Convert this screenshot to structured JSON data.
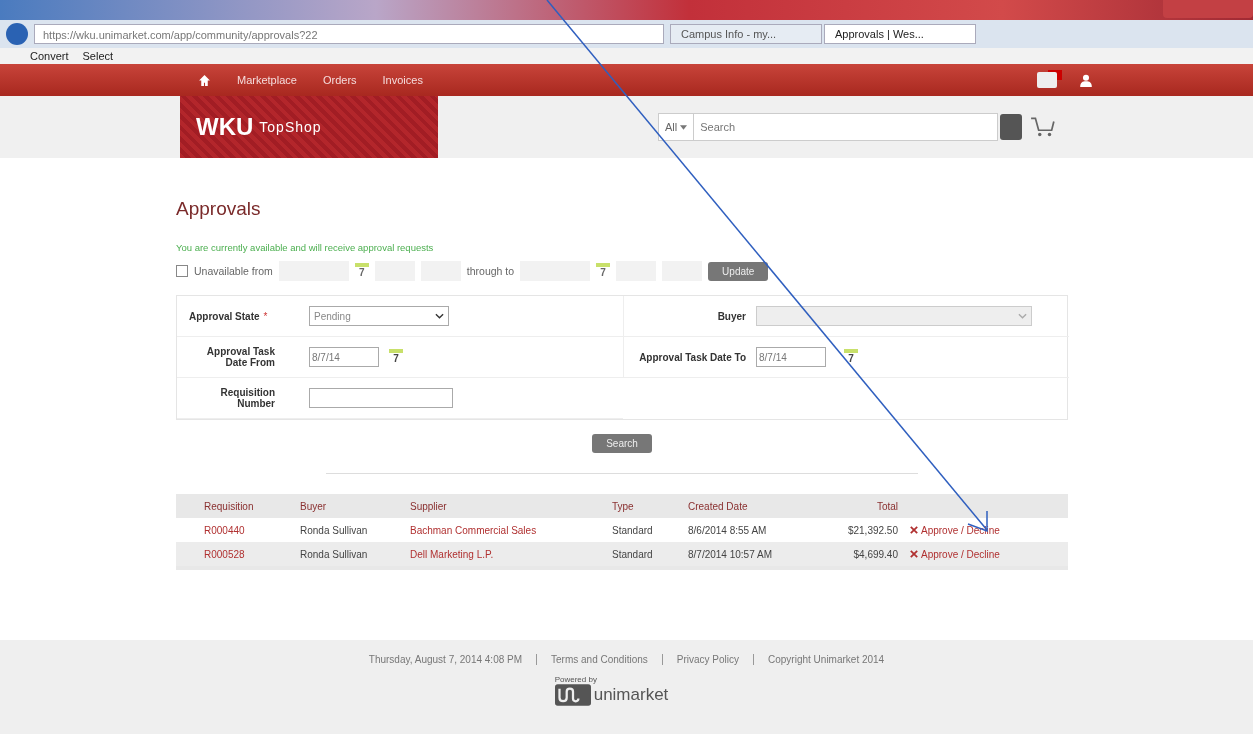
{
  "browser": {
    "url": "https://wku.unimarket.com/app/community/approvals?22",
    "tabs": [
      {
        "label": "Campus Info - my...",
        "selected": false
      },
      {
        "label": "Approvals | Wes...",
        "selected": true
      }
    ],
    "toolbar": [
      "Convert",
      "Select"
    ]
  },
  "nav": {
    "items": [
      "Marketplace",
      "Orders",
      "Invoices"
    ]
  },
  "header": {
    "logo_main": "WKU",
    "logo_sub": "TopShop",
    "search_scope": "All",
    "search_placeholder": "Search"
  },
  "page": {
    "title": "Approvals",
    "status_message": "You are currently available and will receive approval requests",
    "unavailable_label": "Unavailable from",
    "unavailable_checked": false,
    "from_calendar_day": "7",
    "through_label": "through to",
    "to_calendar_day": "7",
    "update_button": "Update"
  },
  "filters": [
    {
      "kind": "select",
      "label": "Approval State",
      "required_mark": "*",
      "value": "Pending",
      "disabled": false
    },
    {
      "kind": "select",
      "label": "Buyer",
      "disabled": true
    },
    {
      "kind": "date",
      "label": "Approval Task Date From",
      "value": "8/7/14",
      "calendar_day": "7",
      "disabled": false
    },
    {
      "kind": "date",
      "label": "Approval Task Date To",
      "value": "8/7/14",
      "calendar_day": "7",
      "disabled": false
    },
    {
      "kind": "text",
      "label": "Requisition Number",
      "disabled": false
    }
  ],
  "search_button": "Search",
  "table": {
    "columns": [
      "Requisition",
      "Buyer",
      "Supplier",
      "Type",
      "Created Date",
      "Total"
    ],
    "rows": [
      {
        "requisition": "R000440",
        "buyer": "Ronda Sullivan",
        "supplier": "Bachman Commercial Sales",
        "type": "Standard",
        "created": "8/6/2014 8:55 AM",
        "total": "$21,392.50",
        "action": "Approve / Decline"
      },
      {
        "requisition": "R000528",
        "buyer": "Ronda Sullivan",
        "supplier": "Dell Marketing L.P.",
        "type": "Standard",
        "created": "8/7/2014 10:57 AM",
        "total": "$4,699.40",
        "action": "Approve / Decline"
      }
    ]
  },
  "footer": {
    "items": [
      "Thursday, August 7, 2014 4:08 PM",
      "Terms and Conditions",
      "Privacy Policy",
      "Copyright Unimarket 2014"
    ],
    "powered_by": "Powered by",
    "brand": "unimarket"
  }
}
